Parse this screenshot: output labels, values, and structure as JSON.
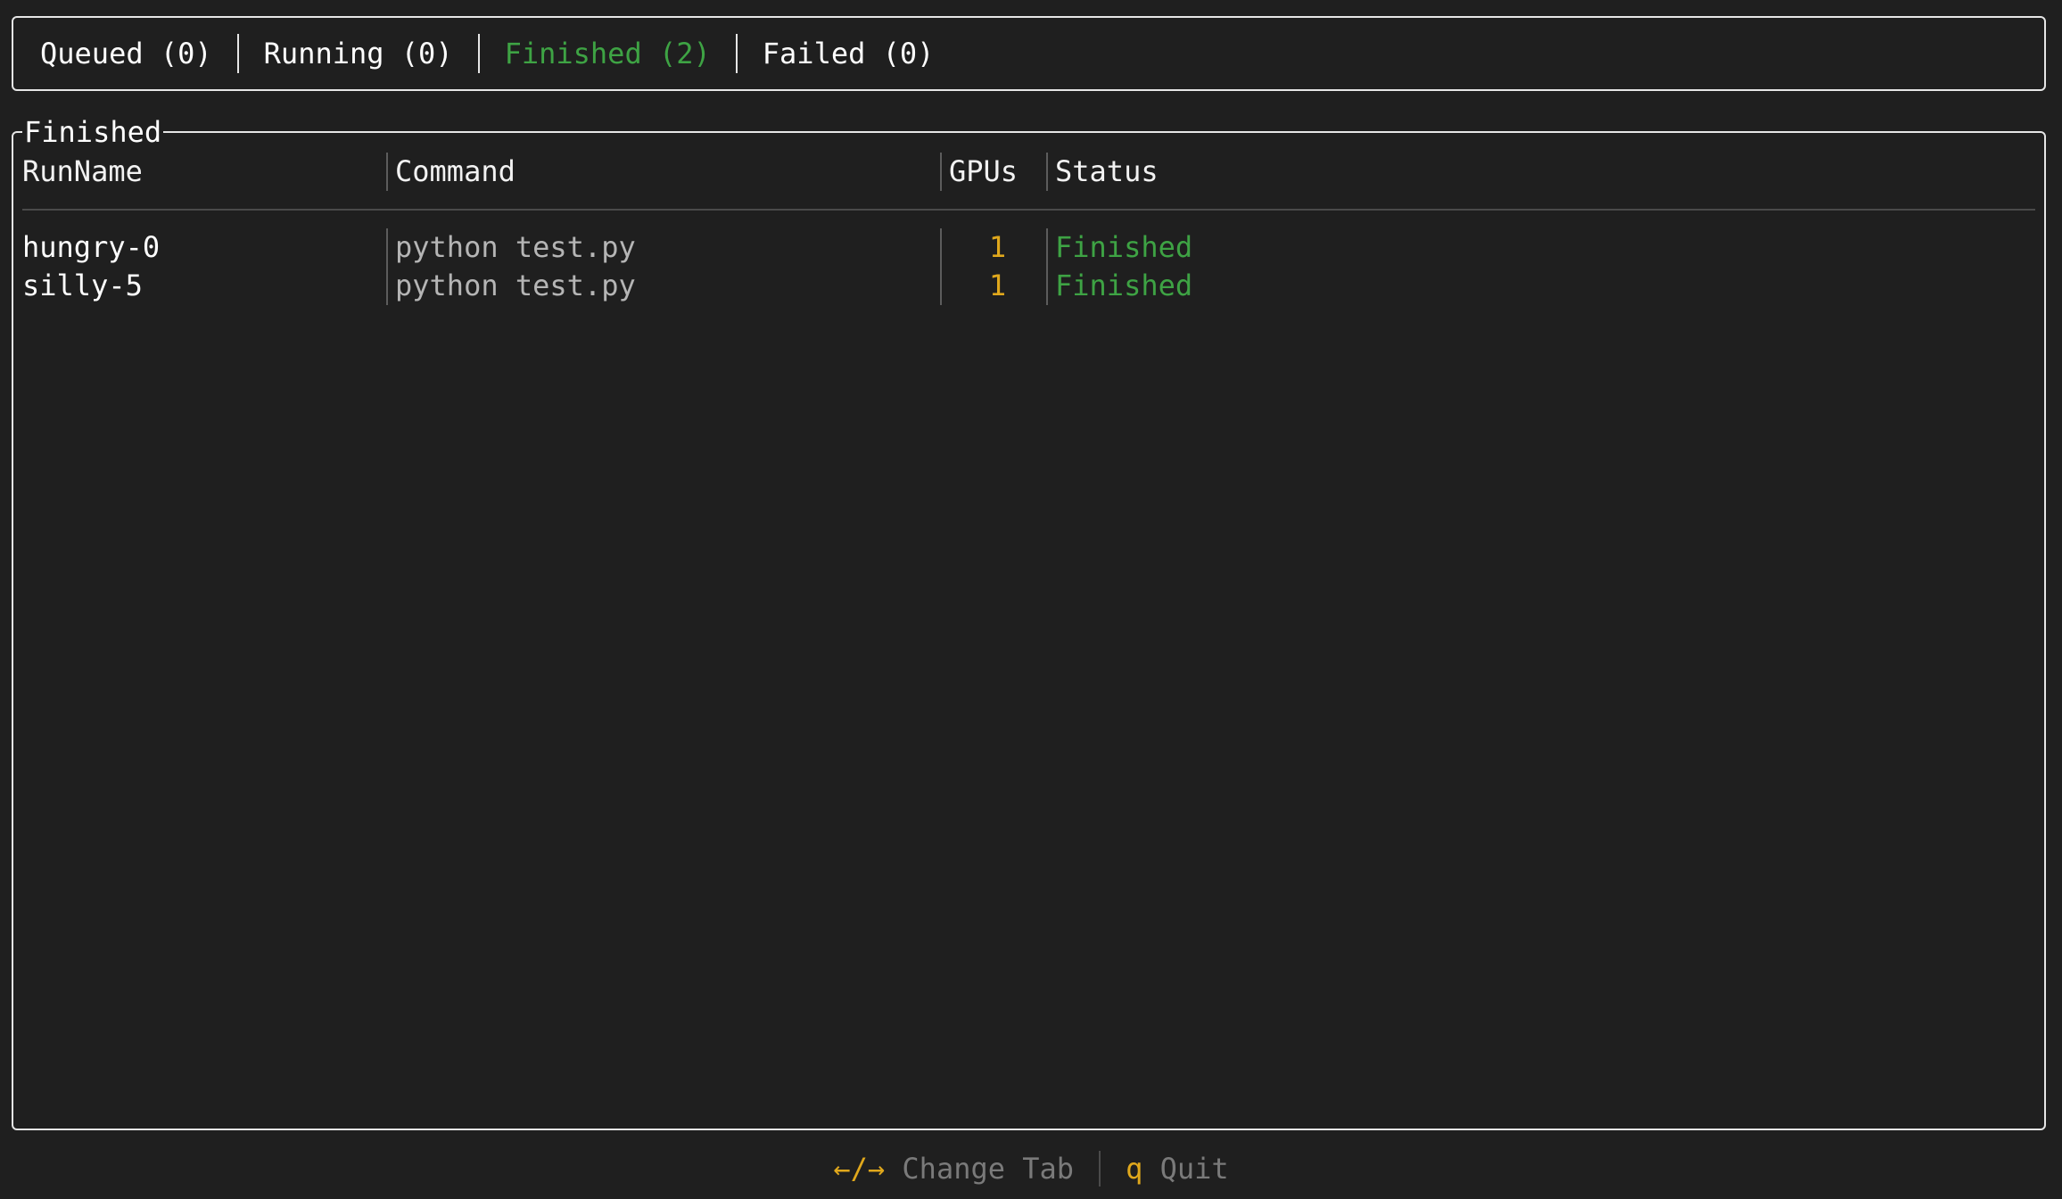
{
  "tabs": [
    {
      "label": "Queued (0)",
      "active": false
    },
    {
      "label": "Running (0)",
      "active": false
    },
    {
      "label": "Finished (2)",
      "active": true
    },
    {
      "label": "Failed (0)",
      "active": false
    }
  ],
  "panel": {
    "title": "Finished",
    "columns": [
      "RunName",
      "Command",
      "GPUs",
      "Status"
    ],
    "rows": [
      {
        "run_name": "hungry-0",
        "command": "python test.py",
        "gpus": "1",
        "status": "Finished"
      },
      {
        "run_name": "silly-5",
        "command": "python test.py",
        "gpus": "1",
        "status": "Finished"
      }
    ]
  },
  "footer": {
    "change_tab_key": "←/→",
    "change_tab_label": "Change Tab",
    "quit_key": "q",
    "quit_label": "Quit"
  },
  "colors": {
    "background": "#1f1f1f",
    "active_tab": "#3ea344",
    "status_finished": "#3ea344",
    "gpu_count": "#e0a81c",
    "key_hint": "#e0a81c",
    "dim_text": "#7a7a7a"
  }
}
